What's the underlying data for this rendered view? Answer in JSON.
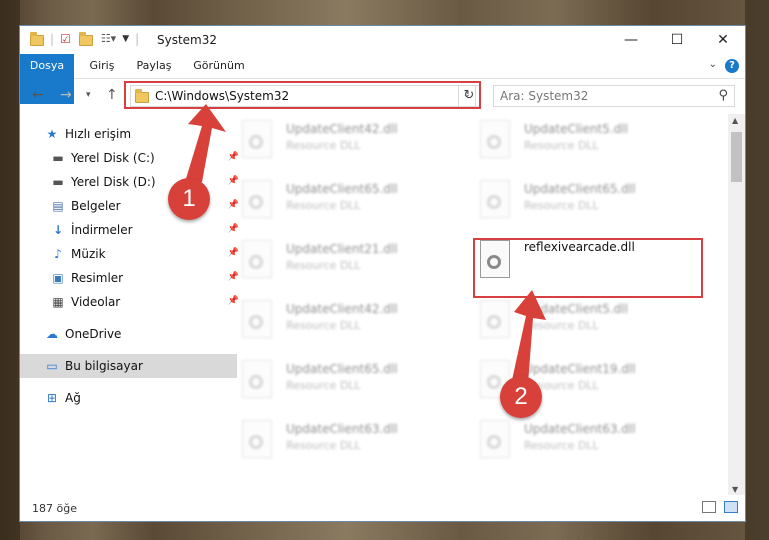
{
  "window": {
    "title": "System32",
    "minimize_glyph": "—",
    "maximize_glyph": "☐",
    "close_glyph": "✕"
  },
  "ribbon": {
    "tabs": [
      {
        "label": "Dosya"
      },
      {
        "label": "Giriş"
      },
      {
        "label": "Paylaş"
      },
      {
        "label": "Görünüm"
      }
    ],
    "help_glyph": "?"
  },
  "nav": {
    "address": "C:\\Windows\\System32",
    "search_placeholder": "Ara: System32"
  },
  "sidebar": {
    "items": [
      {
        "label": "Hızlı erişim",
        "icon": "star-icon"
      },
      {
        "label": "Yerel Disk (C:)",
        "icon": "drive-icon"
      },
      {
        "label": "Yerel Disk (D:)",
        "icon": "drive-icon"
      },
      {
        "label": "Belgeler",
        "icon": "document-icon"
      },
      {
        "label": "İndirmeler",
        "icon": "download-icon"
      },
      {
        "label": "Müzik",
        "icon": "music-icon"
      },
      {
        "label": "Resimler",
        "icon": "pictures-icon"
      },
      {
        "label": "Videolar",
        "icon": "video-icon"
      },
      {
        "label": "OneDrive",
        "icon": "cloud-icon"
      },
      {
        "label": "Bu bilgisayar",
        "icon": "computer-icon"
      },
      {
        "label": "Ağ",
        "icon": "network-icon"
      }
    ]
  },
  "files": [
    {
      "name": "UpdateClient42.dll",
      "type": "Resource DLL"
    },
    {
      "name": "UpdateClient5.dll",
      "type": "Resource DLL"
    },
    {
      "name": "UpdateClient65.dll",
      "type": "Resource DLL"
    },
    {
      "name": "UpdateClient65.dll",
      "type": "Resource DLL"
    },
    {
      "name": "UpdateClient21.dll",
      "type": "Resource DLL"
    },
    {
      "name": "reflexivearcade.dll",
      "type": ""
    },
    {
      "name": "UpdateClient42.dll",
      "type": "Resource DLL"
    },
    {
      "name": "UpdateClient5.dll",
      "type": "Resource DLL"
    },
    {
      "name": "UpdateClient65.dll",
      "type": "Resource DLL"
    },
    {
      "name": "UpdateClient19.dll",
      "type": "Resource DLL"
    },
    {
      "name": "UpdateClient63.dll",
      "type": "Resource DLL"
    },
    {
      "name": "UpdateClient63.dll",
      "type": "Resource DLL"
    }
  ],
  "status": {
    "item_count": "187 öğe"
  },
  "callouts": {
    "one": "1",
    "two": "2"
  },
  "colors": {
    "accent": "#1979ca",
    "highlight": "#d74040",
    "callout": "#d8403a"
  }
}
